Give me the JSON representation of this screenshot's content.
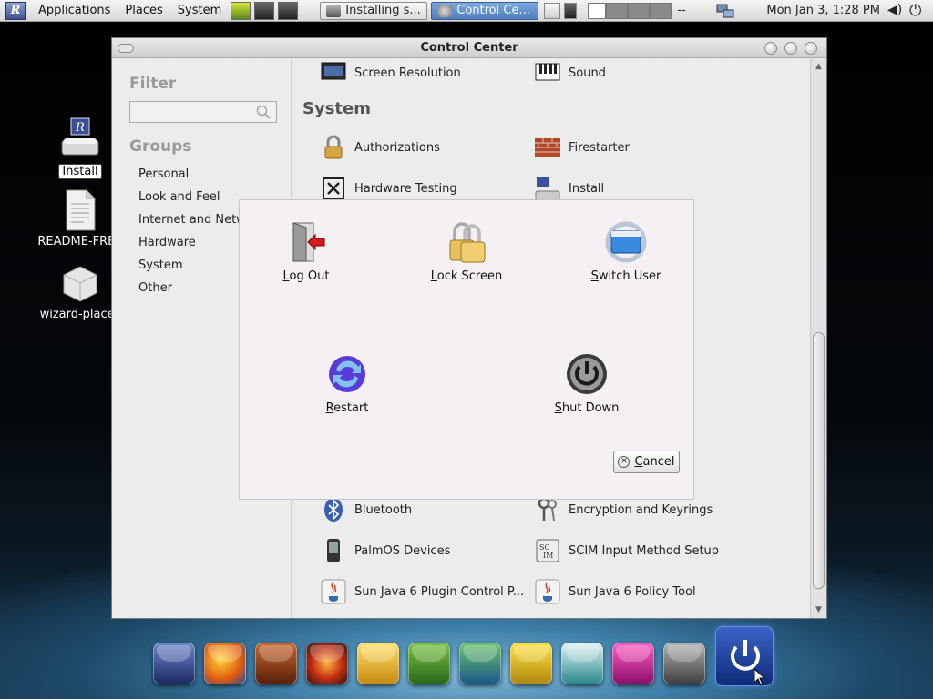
{
  "top_panel": {
    "menus": [
      "Applications",
      "Places",
      "System"
    ],
    "tasks": [
      {
        "label": "Installing s...",
        "active": false
      },
      {
        "label": "Control Ce...",
        "active": true
      }
    ],
    "workspace_more": "--",
    "clock": "Mon Jan  3,  1:28 PM"
  },
  "desktop_icons": [
    {
      "label": "Install",
      "selected": true
    },
    {
      "label": "README-FREE"
    },
    {
      "label": "wizard-places"
    }
  ],
  "window": {
    "title": "Control Center",
    "sidebar": {
      "filter_heading": "Filter",
      "filter_value": "",
      "groups_heading": "Groups",
      "groups": [
        "Personal",
        "Look and Feel",
        "Internet and Netw",
        "Hardware",
        "System",
        "Other"
      ]
    },
    "top_items": [
      "Screen Resolution",
      "Sound"
    ],
    "section_system": "System",
    "system_items": [
      "Authorizations",
      "Firestarter",
      "Hardware Testing",
      "Install"
    ],
    "other_items": [
      "Bluetooth",
      "Encryption and Keyrings",
      "PalmOS Devices",
      "SCIM Input Method Setup",
      "Sun Java 6 Plugin Control P...",
      "Sun Java 6 Policy Tool"
    ]
  },
  "dialog": {
    "logout": {
      "pre": "",
      "key": "L",
      "post": "og Out"
    },
    "lock": {
      "pre": "",
      "key": "L",
      "post": "ock Screen"
    },
    "switch": {
      "pre": "",
      "key": "S",
      "post": "witch User"
    },
    "restart": {
      "pre": "",
      "key": "R",
      "post": "estart"
    },
    "shutdown": {
      "pre": "",
      "key": "S",
      "post": "hut Down"
    },
    "cancel": {
      "pre": "",
      "key": "C",
      "post": "ancel"
    }
  },
  "colors": {
    "dialog_bg": "#f4f0f4",
    "active_task": "#5a8bd0",
    "dock_power": "#1d3c96"
  }
}
